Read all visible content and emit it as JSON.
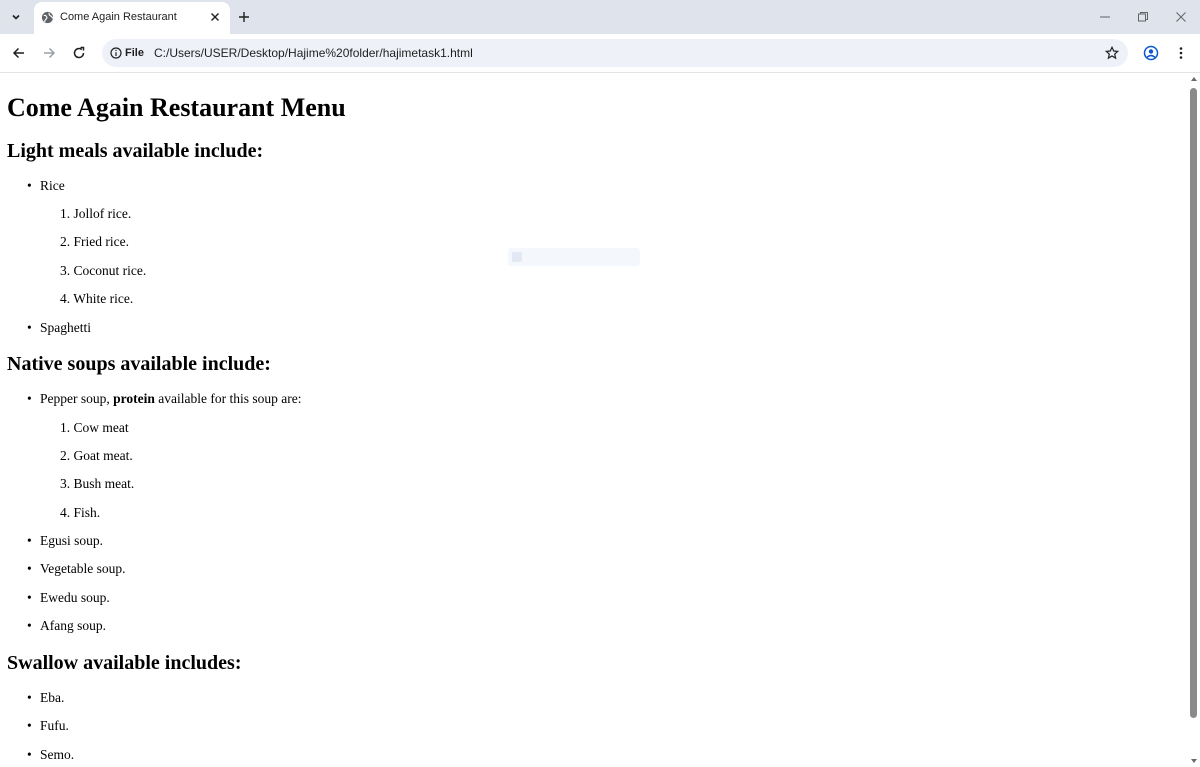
{
  "browser": {
    "tab": {
      "title": "Come Again Restaurant"
    },
    "address": {
      "scheme_label": "File",
      "url": "C:/Users/USER/Desktop/Hajime%20folder/hajimetask1.html"
    }
  },
  "page": {
    "title": "Come Again Restaurant Menu",
    "sections": [
      {
        "heading": "Light meals available include:",
        "rice_label": "Rice",
        "rice_items": [
          "1. Jollof rice.",
          "2. Fried rice.",
          "3. Coconut rice.",
          "4. White rice."
        ],
        "spaghetti_label": "Spaghetti"
      },
      {
        "heading": "Native soups available include:",
        "pepper_prefix": "Pepper soup, ",
        "pepper_bold": "protein",
        "pepper_suffix": " available for this soup are:",
        "protein_items": [
          "1. Cow meat",
          "2. Goat meat.",
          "3. Bush meat.",
          "4. Fish."
        ],
        "other_soups": [
          "Egusi soup.",
          "Vegetable soup.",
          "Ewedu soup.",
          "Afang soup."
        ]
      },
      {
        "heading": "Swallow available includes:",
        "items": [
          "Eba.",
          "Fufu.",
          "Semo."
        ]
      }
    ]
  },
  "icons": {
    "tab_search": "chevron-down-icon",
    "favicon": "globe-icon",
    "close": "close-icon",
    "new_tab": "plus-icon",
    "back": "arrow-left-icon",
    "forward": "arrow-right-icon",
    "reload": "reload-icon",
    "info": "info-icon",
    "bookmark": "star-icon",
    "profile": "profile-icon",
    "menu": "kebab-menu-icon"
  }
}
